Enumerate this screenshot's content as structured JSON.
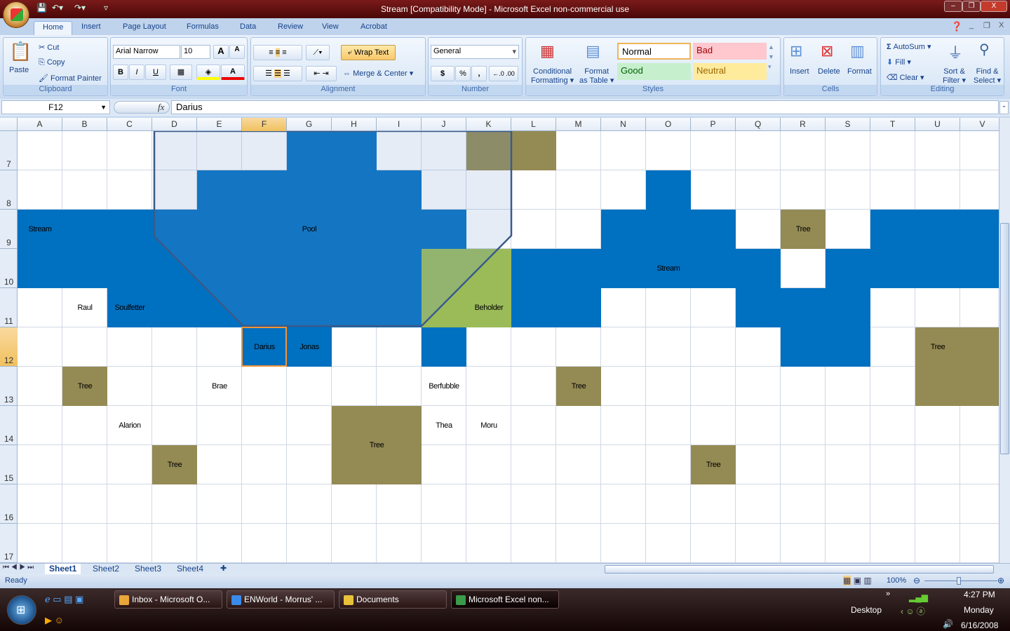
{
  "window": {
    "title": "Stream  [Compatibility Mode] - Microsoft Excel non-commercial use",
    "minimize": "–",
    "restore": "❐",
    "close": "X"
  },
  "tabs": [
    "Home",
    "Insert",
    "Page Layout",
    "Formulas",
    "Data",
    "Review",
    "View",
    "Acrobat"
  ],
  "ribbon": {
    "clipboard": {
      "label": "Clipboard",
      "paste": "Paste",
      "cut": "Cut",
      "copy": "Copy",
      "format_painter": "Format Painter"
    },
    "font": {
      "label": "Font",
      "name": "Arial Narrow",
      "size": "10",
      "bold": "B",
      "italic": "I",
      "underline": "U",
      "grow": "A",
      "shrink": "A"
    },
    "alignment": {
      "label": "Alignment",
      "wrap_text": "Wrap Text",
      "merge_center": "Merge & Center"
    },
    "number": {
      "label": "Number",
      "format": "General",
      "currency": "$",
      "percent": "%",
      "comma": ","
    },
    "styles": {
      "label": "Styles",
      "conditional": "Conditional",
      "conditional2": "Formatting",
      "format_table": "Format",
      "format_table2": "as Table",
      "normal": "Normal",
      "bad": "Bad",
      "good": "Good",
      "neutral": "Neutral"
    },
    "cells": {
      "label": "Cells",
      "insert": "Insert",
      "delete": "Delete",
      "format": "Format"
    },
    "editing": {
      "label": "Editing",
      "autosum": "AutoSum",
      "fill": "Fill",
      "clear": "Clear",
      "sort": "Sort &",
      "sort2": "Filter",
      "find": "Find &",
      "find2": "Select"
    }
  },
  "formula_bar": {
    "name_box": "F12",
    "fx": "fx",
    "value": "Darius"
  },
  "columns": [
    "A",
    "B",
    "C",
    "D",
    "E",
    "F",
    "G",
    "H",
    "I",
    "J",
    "K",
    "L",
    "M",
    "N",
    "O",
    "P",
    "Q",
    "R",
    "S",
    "T",
    "U",
    "V"
  ],
  "selected": {
    "col": "F",
    "row": 12
  },
  "colors": {
    "w": "#ffffff",
    "b": "#0070c0",
    "o": "#948a54",
    "g": "#9bbb59",
    "pool_outline": "#3b5a8a",
    "selection": "#f29436"
  },
  "rows": [
    {
      "num": 7,
      "fills": "wwwwwwbbwwoowwwwwwwwww"
    },
    {
      "num": 8,
      "fills": "wwwwbbbbbwwwwwbwwwwwww"
    },
    {
      "num": 9,
      "fills": "bbbbbbbbbbwwwbbbwowbbb"
    },
    {
      "num": 10,
      "fills": "bbbbbbbbbggbbbbbbwbbbb"
    },
    {
      "num": 11,
      "fills": "wwbbbbbbbggbbwwwbbbwww"
    },
    {
      "num": 12,
      "fills": "wwwwwbbwwbwwwwwwwbbwoo"
    },
    {
      "num": 13,
      "fills": "wowwwwwwwwwwowwwwwwwoo"
    },
    {
      "num": 14,
      "fills": "wwwwwwwoowwwwwwwwwwwww"
    },
    {
      "num": 15,
      "fills": "wwwowwwoowwwwwwowwwwww"
    },
    {
      "num": 16,
      "fills": "wwwwwwwwwwwwwwwwwwwwww"
    },
    {
      "num": 17,
      "fills": "wwwwwwwwwwwwwwwwwwwwww"
    }
  ],
  "labels": [
    {
      "cell": "A9",
      "text": "Stream"
    },
    {
      "cell": "G9",
      "text": "Pool"
    },
    {
      "cell": "R9",
      "text": "Tree"
    },
    {
      "cell": "O10",
      "text": "Stream"
    },
    {
      "cell": "B11",
      "text": "Raul"
    },
    {
      "cell": "C11",
      "text": "Soulfetter"
    },
    {
      "cell": "K11",
      "text": "Beholder"
    },
    {
      "cell": "F12",
      "text": "Darius"
    },
    {
      "cell": "G12",
      "text": "Jonas"
    },
    {
      "cell": "U12",
      "text": "Tree"
    },
    {
      "cell": "B13",
      "text": "Tree"
    },
    {
      "cell": "E13",
      "text": "Brae"
    },
    {
      "cell": "J13",
      "text": "Berfubble"
    },
    {
      "cell": "M13",
      "text": "Tree"
    },
    {
      "cell": "C14",
      "text": "Alarion"
    },
    {
      "cell": "H14",
      "text": "Tree",
      "merge": "H14:I15"
    },
    {
      "cell": "J14",
      "text": "Thea"
    },
    {
      "cell": "K14",
      "text": "Moru"
    },
    {
      "cell": "D15",
      "text": "Tree"
    },
    {
      "cell": "P15",
      "text": "Tree"
    }
  ],
  "sheets": [
    "Sheet1",
    "Sheet2",
    "Sheet3",
    "Sheet4"
  ],
  "active_sheet": "Sheet1",
  "status": {
    "text": "Ready",
    "zoom": "100%"
  },
  "taskbar": {
    "items": [
      "Inbox - Microsoft O...",
      "ENWorld - Morrus' ...",
      "Documents",
      "Microsoft Excel non..."
    ],
    "desktop": "Desktop",
    "time": "4:27 PM",
    "day": "Monday",
    "date": "6/16/2008"
  }
}
